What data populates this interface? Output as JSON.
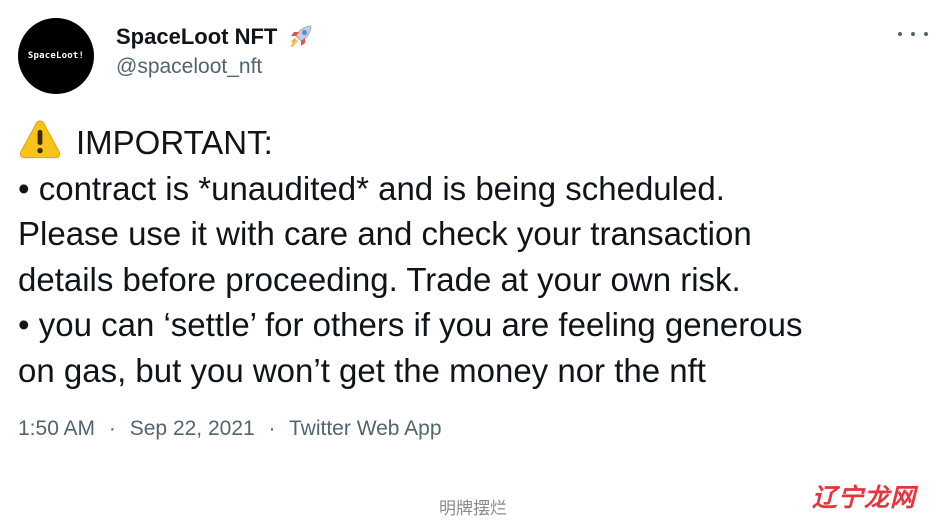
{
  "account": {
    "display_name": "SpaceLoot NFT",
    "handle": "@spaceloot_nft",
    "avatar_text": "SpaceLoot!",
    "name_emoji_icon": "rocket-icon"
  },
  "tweet": {
    "header_icon": "warning-icon",
    "lines": [
      "IMPORTANT:",
      "• contract is *unaudited* and is being scheduled.",
      "Please use it with care and check your transaction",
      "details before proceeding. Trade at your own risk.",
      "• you can ‘settle’ for others if you are feeling generous",
      "on gas, but you won’t get the money nor the nft"
    ],
    "time": "1:50 AM",
    "date": "Sep 22, 2021",
    "source": "Twitter Web App",
    "separator": "·"
  },
  "more_icon": "more-horizontal-icon",
  "watermarks": {
    "center_text": "明牌摆烂",
    "logo_text": "辽宁龙网"
  },
  "colors": {
    "text_primary": "#0f1419",
    "text_secondary": "#536471",
    "background": "#ffffff",
    "avatar_bg": "#000000",
    "watermark_logo": "#e8323c"
  }
}
